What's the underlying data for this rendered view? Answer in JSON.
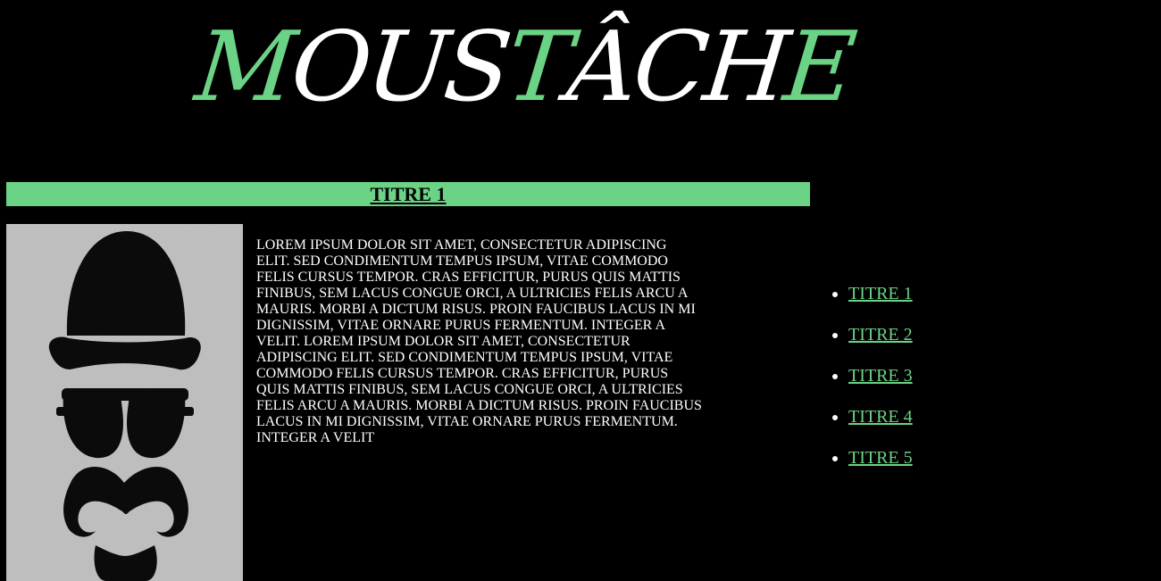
{
  "logo": {
    "letters": [
      {
        "char": "M",
        "color": "green"
      },
      {
        "char": "O",
        "color": "white"
      },
      {
        "char": "U",
        "color": "white"
      },
      {
        "char": "S",
        "color": "white"
      },
      {
        "char": "T",
        "color": "green"
      },
      {
        "char": "Â",
        "color": "white"
      },
      {
        "char": "C",
        "color": "white"
      },
      {
        "char": "H",
        "color": "white"
      },
      {
        "char": "E",
        "color": "green"
      }
    ]
  },
  "section": {
    "title": "TITRE 1"
  },
  "image": {
    "description": "mustache-gentleman-illustration"
  },
  "content": {
    "paragraph": "LOREM IPSUM DOLOR SIT AMET, CONSECTETUR ADIPISCING ELIT. SED CONDIMENTUM TEMPUS IPSUM, VITAE COMMODO FELIS CURSUS TEMPOR. CRAS EFFICITUR, PURUS QUIS MATTIS FINIBUS, SEM LACUS CONGUE ORCI, A ULTRICIES FELIS ARCU A MAURIS. MORBI A DICTUM RISUS. PROIN FAUCIBUS LACUS IN MI DIGNISSIM, VITAE ORNARE PURUS FERMENTUM. INTEGER A VELIT. LOREM IPSUM DOLOR SIT AMET, CONSECTETUR ADIPISCING ELIT. SED CONDIMENTUM TEMPUS IPSUM, VITAE COMMODO FELIS CURSUS TEMPOR. CRAS EFFICITUR, PURUS QUIS MATTIS FINIBUS, SEM LACUS CONGUE ORCI, A ULTRICIES FELIS ARCU A MAURIS. MORBI A DICTUM RISUS. PROIN FAUCIBUS LACUS IN MI DIGNISSIM, VITAE ORNARE PURUS FERMENTUM. INTEGER A VELIT"
  },
  "nav": {
    "items": [
      {
        "label": "TITRE 1"
      },
      {
        "label": "TITRE 2"
      },
      {
        "label": "TITRE 3"
      },
      {
        "label": "TITRE 4"
      },
      {
        "label": "TITRE 5"
      }
    ]
  },
  "colors": {
    "accent": "#6bd385",
    "background": "#000000",
    "text": "#ffffff"
  }
}
